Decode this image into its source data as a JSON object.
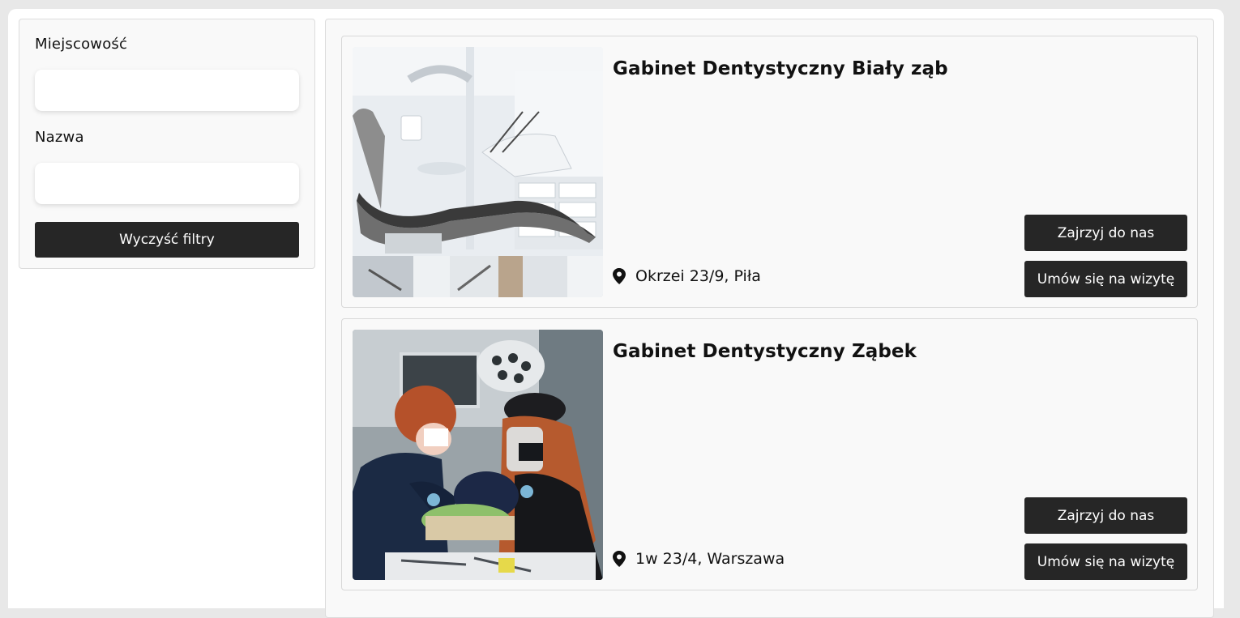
{
  "filters": {
    "city_label": "Miejscowość",
    "city_value": "",
    "name_label": "Nazwa",
    "name_value": "",
    "clear_button": "Wyczyść filtry"
  },
  "clinics": [
    {
      "name": "Gabinet Dentystyczny Biały ząb",
      "address": "Okrzei 23/9, Piła",
      "visit_button": "Zajrzyj do nas",
      "book_button": "Umów się na wizytę"
    },
    {
      "name": "Gabinet Dentystyczny Ząbek",
      "address": "1w 23/4, Warszawa",
      "visit_button": "Zajrzyj do nas",
      "book_button": "Umów się na wizytę"
    }
  ],
  "icons": {
    "location": "map-pin-icon"
  },
  "colors": {
    "button_bg": "#262626",
    "button_text": "#ffffff",
    "panel_bg": "#f9f9f9",
    "page_bg": "#e8e8e8"
  }
}
